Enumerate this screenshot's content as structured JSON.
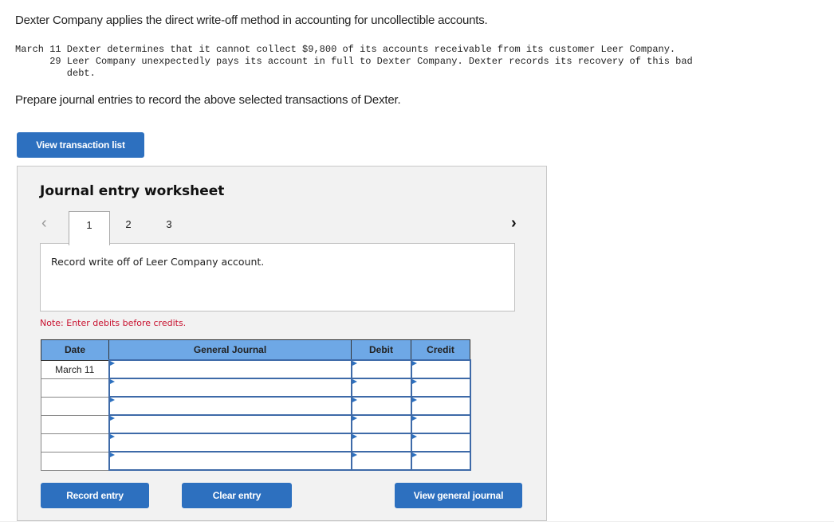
{
  "intro": "Dexter Company applies the direct write-off method in accounting for uncollectible accounts.",
  "transactions": [
    "March 11 Dexter determines that it cannot collect $9,800 of its accounts receivable from its customer Leer Company.",
    "      29 Leer Company unexpectedly pays its account in full to Dexter Company. Dexter records its recovery of this bad",
    "         debt."
  ],
  "prompt": "Prepare journal entries to record the above selected transactions of Dexter.",
  "buttons": {
    "view_transaction_list": "View transaction list",
    "record_entry": "Record entry",
    "clear_entry": "Clear entry",
    "view_general_journal": "View general journal"
  },
  "worksheet": {
    "title": "Journal entry worksheet",
    "tabs": [
      "1",
      "2",
      "3"
    ],
    "active_tab": "1",
    "description": "Record write off of Leer Company account.",
    "note": "Note: Enter debits before credits.",
    "columns": [
      "Date",
      "General Journal",
      "Debit",
      "Credit"
    ],
    "rows": [
      {
        "date": "March 11",
        "account": "",
        "debit": "",
        "credit": ""
      },
      {
        "date": "",
        "account": "",
        "debit": "",
        "credit": ""
      },
      {
        "date": "",
        "account": "",
        "debit": "",
        "credit": ""
      },
      {
        "date": "",
        "account": "",
        "debit": "",
        "credit": ""
      },
      {
        "date": "",
        "account": "",
        "debit": "",
        "credit": ""
      },
      {
        "date": "",
        "account": "",
        "debit": "",
        "credit": ""
      }
    ]
  }
}
